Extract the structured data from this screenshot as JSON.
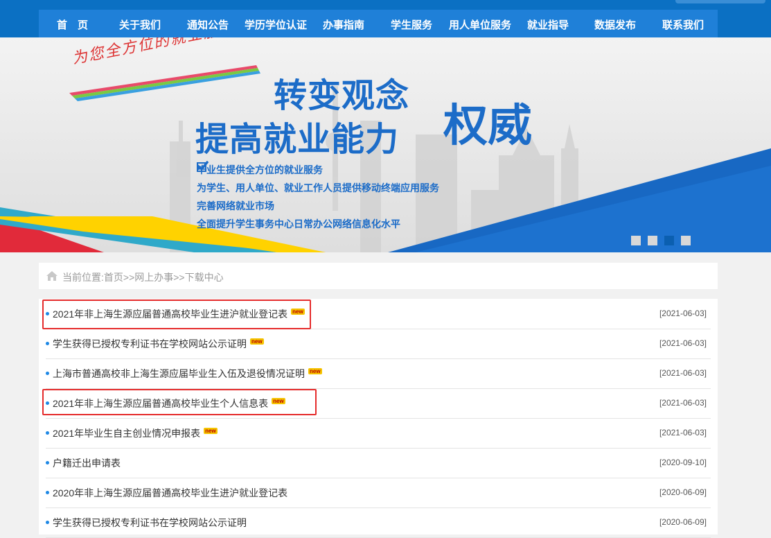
{
  "nav": {
    "items": [
      "首　页",
      "关于我们",
      "通知公告",
      "学历学位认证",
      "办事指南",
      "学生服务",
      "用人单位服务",
      "就业指导",
      "数据发布",
      "联系我们"
    ]
  },
  "banner": {
    "slogan": "为您全方位的就业服务",
    "headline1": "转变观念",
    "headline2": "提高就业能力",
    "headline3": "权威",
    "bullets": [
      "毕业生提供全方位的就业服务",
      "为学生、用人单位、就业工作人员提供移动终端应用服务",
      "完善网络就业市场",
      "全面提升学生事务中心日常办公网络信息化水平"
    ],
    "slide_count": 4,
    "active_slide": 3
  },
  "breadcrumb": {
    "text": "当前位置:首页>>网上办事>>下载中心"
  },
  "list": [
    {
      "title": "2021年非上海生源应届普通高校毕业生进沪就业登记表",
      "new": "new",
      "date": "[2021-06-03]",
      "highlighted": true
    },
    {
      "title": "学生获得已授权专利证书在学校网站公示证明",
      "new": "new",
      "date": "[2021-06-03]",
      "highlighted": false
    },
    {
      "title": "上海市普通高校非上海生源应届毕业生入伍及退役情况证明",
      "new": "new",
      "date": "[2021-06-03]",
      "highlighted": false
    },
    {
      "title": "2021年非上海生源应届普通高校毕业生个人信息表",
      "new": "new",
      "date": "[2021-06-03]",
      "highlighted": true
    },
    {
      "title": "2021年毕业生自主创业情况申报表",
      "new": "new",
      "date": "[2021-06-03]",
      "highlighted": false
    },
    {
      "title": "户籍迁出申请表",
      "new": "",
      "date": "[2020-09-10]",
      "highlighted": false
    },
    {
      "title": "2020年非上海生源应届普通高校毕业生进沪就业登记表",
      "new": "",
      "date": "[2020-06-09]",
      "highlighted": false
    },
    {
      "title": "学生获得已授权专利证书在学校网站公示证明",
      "new": "",
      "date": "[2020-06-09]",
      "highlighted": false
    }
  ],
  "colors": {
    "nav_bg": "#0b70c3",
    "accent": "#1c6cc8",
    "highlight_box": "#e52b2b"
  }
}
